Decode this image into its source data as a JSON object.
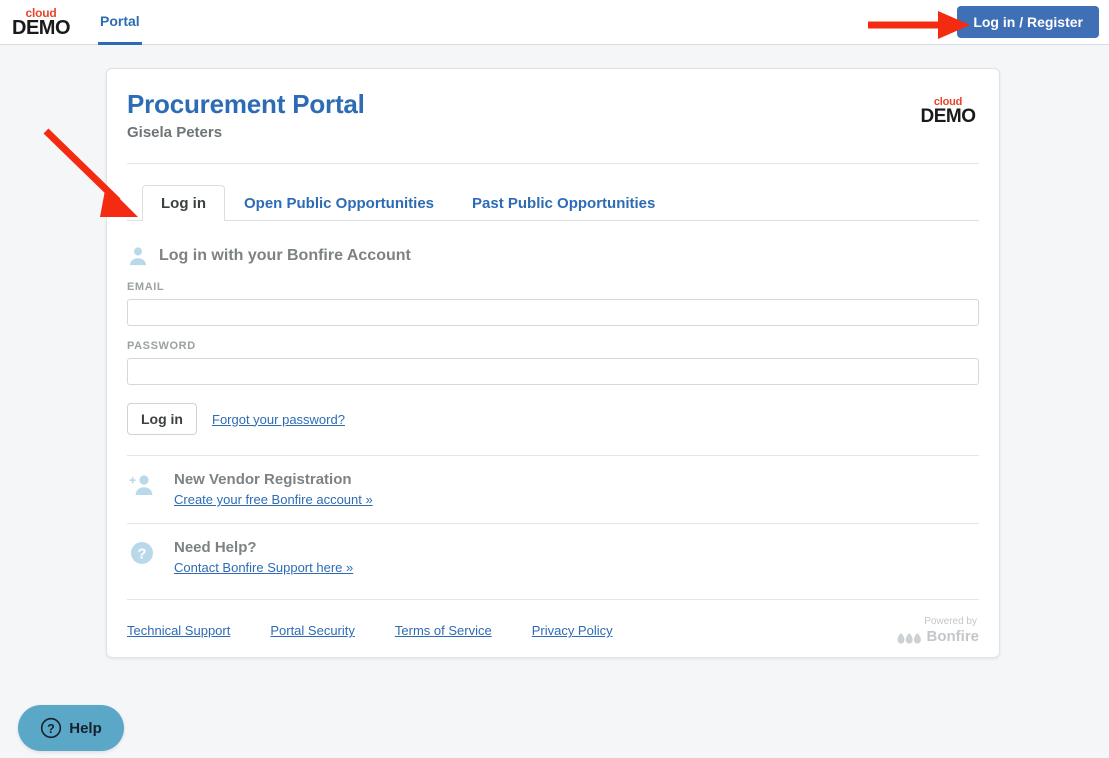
{
  "topbar": {
    "logo": {
      "line1": "cloud",
      "line2": "DEMO"
    },
    "nav": [
      {
        "label": "Portal",
        "active": true
      }
    ],
    "login_register_button": "Log in / Register"
  },
  "card": {
    "title": "Procurement Portal",
    "subtitle": "Gisela Peters",
    "logo": {
      "line1": "cloud",
      "line2": "DEMO"
    },
    "tabs": [
      {
        "label": "Log in",
        "active": true
      },
      {
        "label": "Open Public Opportunities",
        "active": false
      },
      {
        "label": "Past Public Opportunities",
        "active": false
      }
    ],
    "login": {
      "section_title": "Log in with your Bonfire Account",
      "section_icon": "user-icon",
      "email_label": "EMAIL",
      "email_value": "",
      "email_placeholder": "",
      "password_label": "PASSWORD",
      "password_value": "",
      "password_placeholder": "",
      "login_button": "Log in",
      "forgot_link": "Forgot your password?"
    },
    "vendor": {
      "icon": "add-user-icon",
      "title": "New Vendor Registration",
      "link": "Create your free Bonfire account »"
    },
    "help": {
      "icon": "question-circle-icon",
      "title": "Need Help?",
      "link": "Contact Bonfire Support here »"
    },
    "footer": {
      "links": [
        "Technical Support",
        "Portal Security",
        "Terms of Service",
        "Privacy Policy"
      ],
      "powered_by": "Powered by",
      "powered_brand": "Bonfire"
    }
  },
  "help_widget": {
    "label": "Help",
    "icon": "question-circle-icon",
    "color": "#5ba7c7"
  },
  "annotations": {
    "arrow_color": "#f42b11",
    "arrow_topbar_target": "Log in / Register",
    "arrow_tab_target": "Log in"
  },
  "colors": {
    "page_background": "#f4f6f8",
    "accent_blue": "#2d6cb5",
    "button_blue": "#3f6fb5",
    "logo_red": "#e8442a",
    "muted_gray": "#7d8285"
  }
}
